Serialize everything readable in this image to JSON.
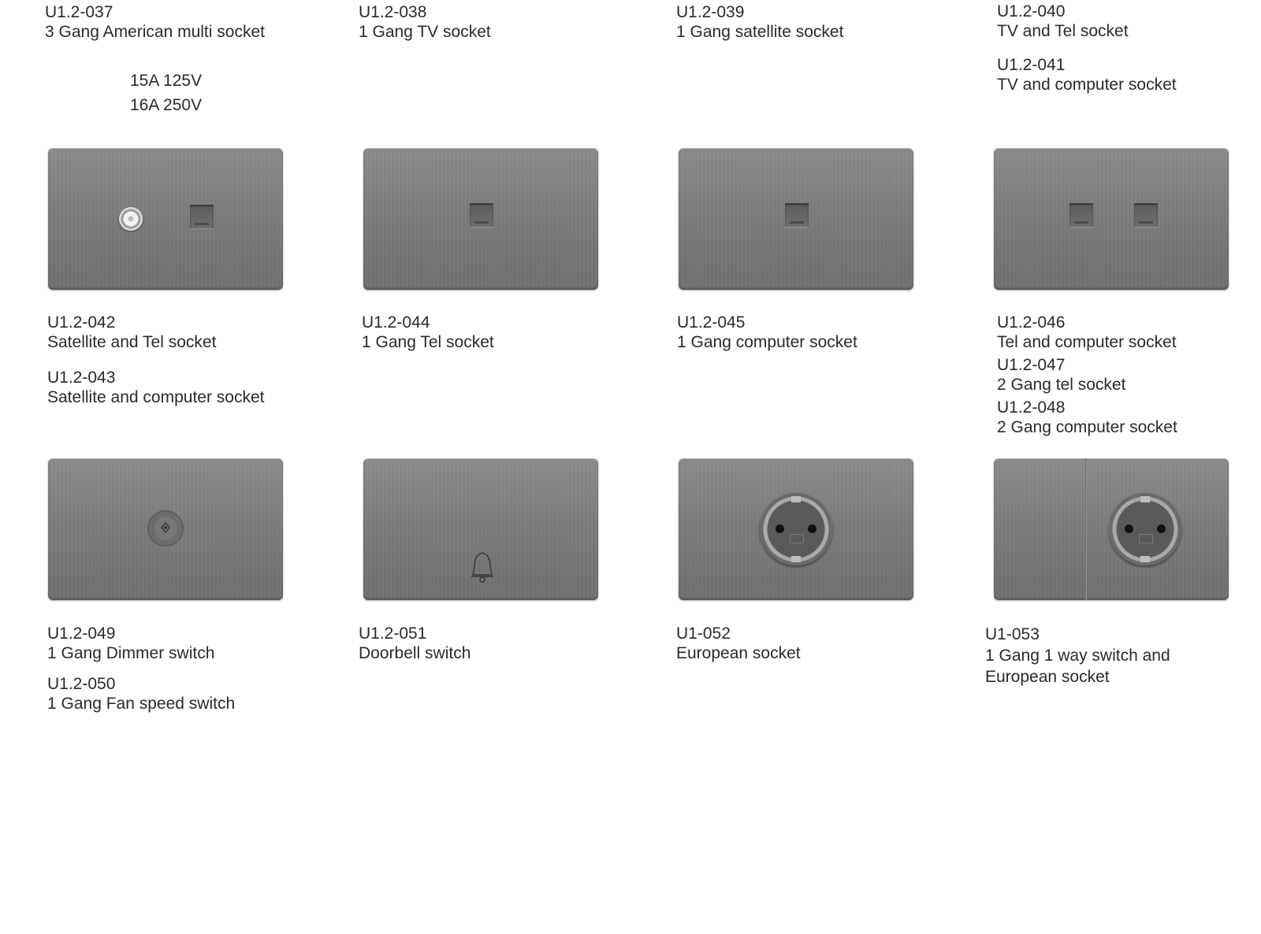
{
  "row1": [
    {
      "code": "U1.2-037",
      "name": "3 Gang American multi socket"
    },
    {
      "code": "U1.2-038",
      "name": "1 Gang TV socket"
    },
    {
      "code": "U1.2-039",
      "name": "1 Gang satellite socket"
    },
    {
      "code": "U1.2-040",
      "name": "TV and Tel socket",
      "code2": "U1.2-041",
      "name2": "TV and computer socket"
    }
  ],
  "ratings": [
    "15A 125V",
    "16A 250V"
  ],
  "row2": [
    {
      "code": "U1.2-042",
      "name": "Satellite and Tel socket",
      "code2": "U1.2-043",
      "name2": "Satellite and computer socket"
    },
    {
      "code": "U1.2-044",
      "name": "1 Gang Tel socket"
    },
    {
      "code": "U1.2-045",
      "name": "1 Gang computer socket"
    },
    {
      "code": "U1.2-046",
      "name": "Tel and computer socket",
      "code2": "U1.2-047",
      "name2": "2 Gang tel socket",
      "code3": "U1.2-048",
      "name3": "2 Gang computer socket"
    }
  ],
  "row3": [
    {
      "code": "U1.2-049",
      "name": "1 Gang Dimmer switch",
      "code2": "U1.2-050",
      "name2": "1 Gang Fan speed switch"
    },
    {
      "code": "U1.2-051",
      "name": "Doorbell switch"
    },
    {
      "code": "U1-052",
      "name": "European socket"
    },
    {
      "code": "U1-053",
      "name": "1 Gang 1 way switch and",
      "name_line2": "European socket"
    }
  ],
  "icons": {
    "plate1": [
      "coax-icon",
      "tel-port-icon"
    ],
    "plate2": [
      "tel-port-icon"
    ],
    "plate3": [
      "tel-port-icon"
    ],
    "plate4": [
      "tel-port-icon",
      "tel-port-icon"
    ],
    "plate5": [
      "dimmer-knob-icon"
    ],
    "plate6": [
      "bell-icon"
    ],
    "plate7": [
      "european-socket-icon"
    ],
    "plate8": [
      "european-socket-icon"
    ]
  },
  "colors": {
    "plate": "#7c7c7e",
    "text": "#2a2a2a",
    "background": "#ffffff"
  }
}
